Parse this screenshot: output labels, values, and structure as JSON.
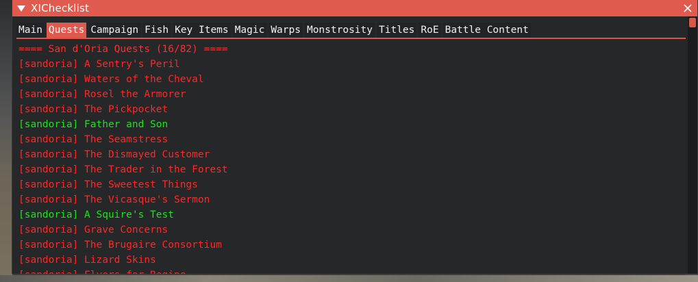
{
  "window": {
    "title": "XIChecklist"
  },
  "tabs": [
    {
      "label": "Main",
      "active": false
    },
    {
      "label": "Quests",
      "active": true
    },
    {
      "label": "Campaign",
      "active": false
    },
    {
      "label": "Fish",
      "active": false
    },
    {
      "label": "Key Items",
      "active": false
    },
    {
      "label": "Magic",
      "active": false
    },
    {
      "label": "Warps",
      "active": false
    },
    {
      "label": "Monstrosity",
      "active": false
    },
    {
      "label": "Titles",
      "active": false
    },
    {
      "label": "RoE",
      "active": false
    },
    {
      "label": "Battle Content",
      "active": false
    }
  ],
  "section": {
    "header": "==== San d'Oria Quests (16/82) ===="
  },
  "quests": [
    {
      "text": "[sandoria] A Sentry's Peril",
      "complete": false
    },
    {
      "text": "[sandoria] Waters of the Cheval",
      "complete": false
    },
    {
      "text": "[sandoria] Rosel the Armorer",
      "complete": false
    },
    {
      "text": "[sandoria] The Pickpocket",
      "complete": false
    },
    {
      "text": "[sandoria] Father and Son",
      "complete": true
    },
    {
      "text": "[sandoria] The Seamstress",
      "complete": false
    },
    {
      "text": "[sandoria] The Dismayed Customer",
      "complete": false
    },
    {
      "text": "[sandoria] The Trader in the Forest",
      "complete": false
    },
    {
      "text": "[sandoria] The Sweetest Things",
      "complete": false
    },
    {
      "text": "[sandoria] The Vicasque's Sermon",
      "complete": false
    },
    {
      "text": "[sandoria] A Squire's Test",
      "complete": true
    },
    {
      "text": "[sandoria] Grave Concerns",
      "complete": false
    },
    {
      "text": "[sandoria] The Brugaire Consortium",
      "complete": false
    },
    {
      "text": "[sandoria] Lizard Skins",
      "complete": false
    },
    {
      "text": "[sandoria] Flyers for Regine",
      "complete": false
    }
  ],
  "colors": {
    "accent": "#e05b4e",
    "incomplete": "#ff2828",
    "complete": "#1ee21e",
    "window_bg": "#252729"
  },
  "icons": {
    "collapse": "triangle-down-icon",
    "close": "close-icon"
  }
}
